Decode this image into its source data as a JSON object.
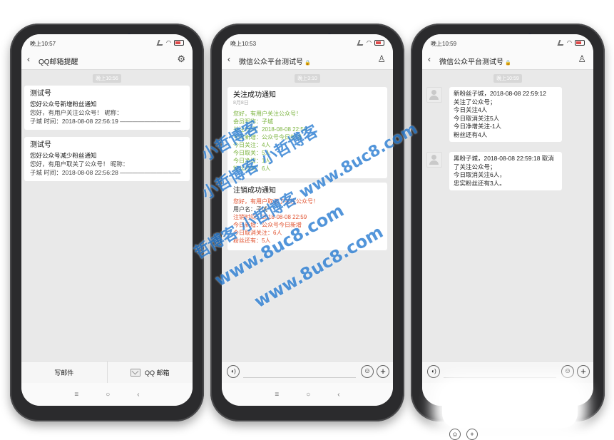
{
  "phones": [
    {
      "status_time": "晚上10:57",
      "nav_title": "QQ邮箱提醒",
      "timestamp": "晚上10:56",
      "messages": [
        {
          "title": "测试号",
          "subtitle": "您好公众号新增粉丝通知",
          "line1": "您好，有用户关注公众号！ 昵称：",
          "line2": "子城 时间：2018-08-08 22:56:19 ——————————"
        },
        {
          "title": "测试号",
          "subtitle": "您好公众号减少粉丝通知",
          "line1": "您好，有用户取关了公众号！ 昵称：",
          "line2": "子城 时间：2018-08-08 22:56:28 ——————————"
        }
      ],
      "bottom_tabs": [
        "写邮件",
        "QQ 邮箱"
      ]
    },
    {
      "status_time": "晚上10:53",
      "nav_title": "微信公众平台测试号",
      "timestamp": "晚上3:10",
      "template_cards": [
        {
          "title": "关注成功通知",
          "date": "8月8日",
          "lines": [
            {
              "text": "您好，有用户关注公众号！",
              "color": "green"
            },
            {
              "text": "会员昵称：子城",
              "color": "green"
            },
            {
              "text": "关注时间：2018-08-08 22:59",
              "color": "green"
            },
            {
              "text": "今日新增：公众号今日新增",
              "color": "green"
            },
            {
              "text": "今日关注：4人",
              "color": "green"
            },
            {
              "text": "今日取关：5人",
              "color": "green"
            },
            {
              "text": "今日净增：1人",
              "color": "green"
            },
            {
              "text": "粉丝还有：6人",
              "color": "green"
            }
          ]
        },
        {
          "title": "注销成功通知",
          "date": "",
          "lines": [
            {
              "text": "您好，有用户取消了关注公众号！",
              "color": "red"
            },
            {
              "text": "用户名：子城",
              "color": "dark"
            },
            {
              "text": "注销时间：2018-08-08 22:59",
              "color": "red"
            },
            {
              "text": "今日新增：公众号今日新增",
              "color": "red"
            },
            {
              "text": "今日取消关注：6人",
              "color": "red"
            },
            {
              "text": "粉丝还有：5人",
              "color": "red"
            }
          ]
        }
      ]
    },
    {
      "status_time": "晚上10:59",
      "nav_title": "微信公众平台测试号",
      "timestamp": "晚上10:59",
      "chat": [
        {
          "lines": [
            "新粉丝子城，2018-08-08 22:59:12",
            "关注了公众号；",
            "今日关注4人",
            "今日取消关注5人",
            "今日净增关注-1人",
            "粉丝还有4人"
          ]
        },
        {
          "lines": [
            "黑粉子城，2018-08-08 22:59:18 取消了关注公众号；",
            "今日取消关注6人，",
            "忠实粉丝还有3人。"
          ]
        }
      ]
    }
  ],
  "watermarks": [
    "小哲博客",
    "小哲博客 小哲博客",
    "哲博客 小哲博客 www.8uc8.com",
    "www.8uc8.com",
    "www.8uc8.com"
  ]
}
